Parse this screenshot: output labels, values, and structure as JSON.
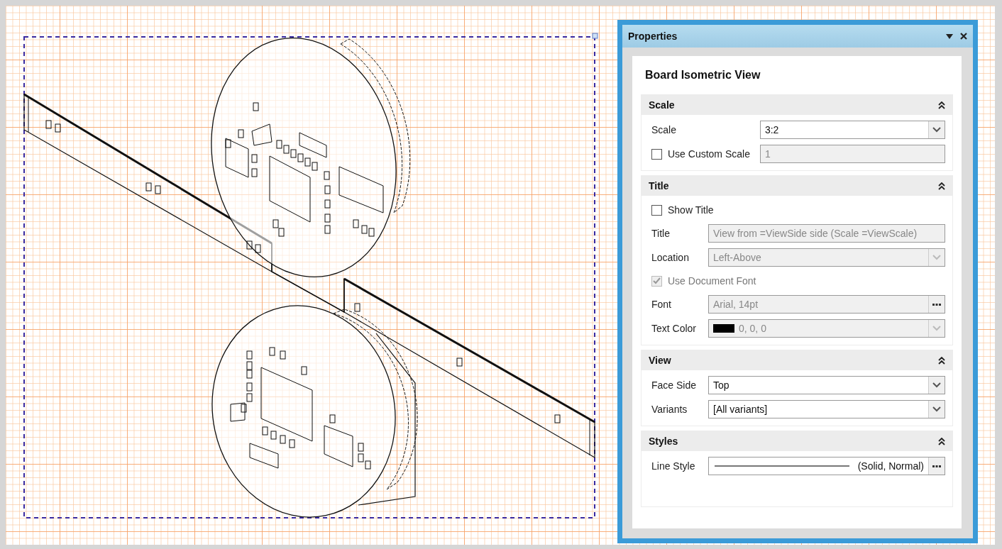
{
  "panel": {
    "title": "Properties",
    "heading": "Board Isometric View",
    "sections": [
      {
        "title": "Scale",
        "expanded": true,
        "rows": [
          {
            "kind": "dropdown",
            "label": "Scale",
            "value": "3:2",
            "disabled": false
          },
          {
            "kind": "checkbox",
            "label": "Use Custom Scale",
            "checked": false,
            "disabled": false,
            "value": "1",
            "value_disabled": true
          }
        ]
      },
      {
        "title": "Title",
        "expanded": true,
        "rows": [
          {
            "kind": "checkbox",
            "label": "Show Title",
            "checked": false,
            "disabled": false
          },
          {
            "kind": "text",
            "label": "Title",
            "value": "View from =ViewSide side (Scale =ViewScale)",
            "disabled": true
          },
          {
            "kind": "dropdown",
            "label": "Location",
            "value": "Left-Above",
            "disabled": true
          },
          {
            "kind": "checkbox",
            "label": "Use Document Font",
            "checked": true,
            "disabled": true
          },
          {
            "kind": "font",
            "label": "Font",
            "value": "Arial, 14pt",
            "disabled": true
          },
          {
            "kind": "color",
            "label": "Text Color",
            "value": "0, 0, 0",
            "color": "#000000",
            "disabled": true
          }
        ]
      },
      {
        "title": "View",
        "expanded": true,
        "rows": [
          {
            "kind": "dropdown",
            "label": "Face Side",
            "value": "Top",
            "disabled": false
          },
          {
            "kind": "dropdown",
            "label": "Variants",
            "value": "[All variants]",
            "disabled": false
          }
        ]
      },
      {
        "title": "Styles",
        "expanded": true,
        "rows": [
          {
            "kind": "linestyle",
            "label": "Line Style",
            "value": "(Solid, Normal)",
            "disabled": false
          }
        ]
      }
    ]
  }
}
